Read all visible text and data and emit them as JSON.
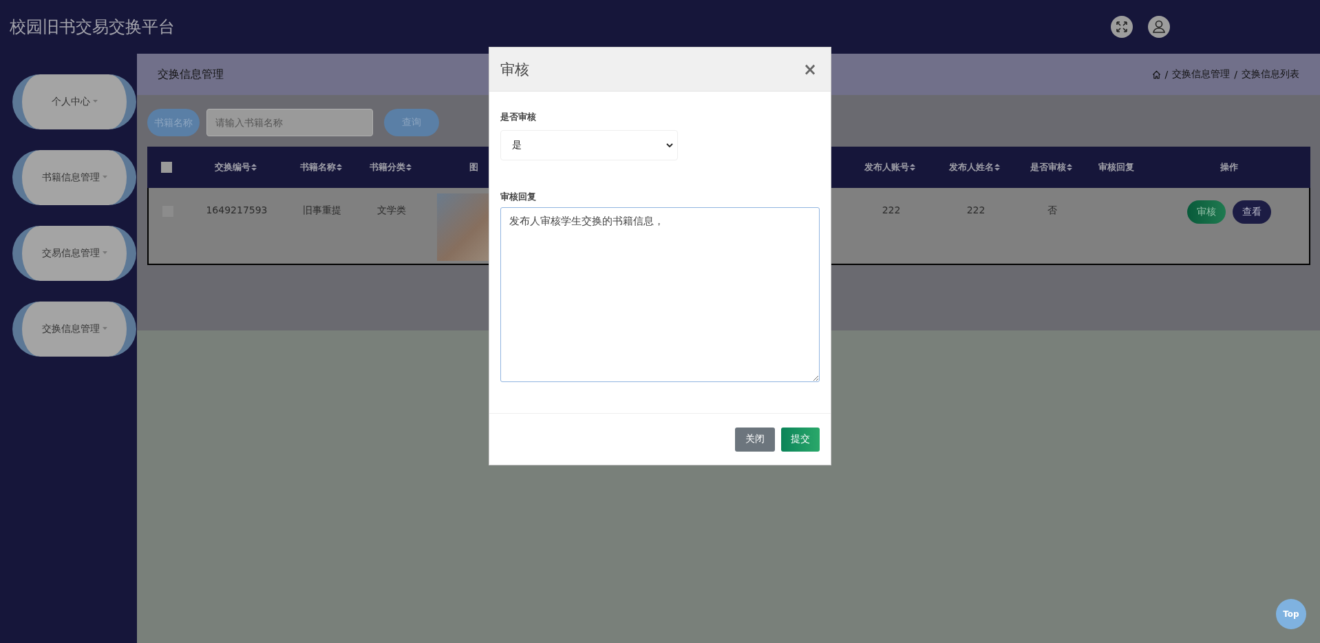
{
  "header": {
    "title": "校园旧书交易交换平台"
  },
  "sidebar": {
    "items": [
      {
        "label": "个人中心"
      },
      {
        "label": "书籍信息管理"
      },
      {
        "label": "交易信息管理"
      },
      {
        "label": "交换信息管理"
      }
    ]
  },
  "page": {
    "title": "交换信息管理"
  },
  "breadcrumb": [
    {
      "kind": "home"
    },
    {
      "kind": "sep",
      "text": "/"
    },
    {
      "kind": "link",
      "text": "交换信息管理"
    },
    {
      "kind": "sep",
      "text": "/"
    },
    {
      "kind": "link",
      "text": "交换信息列表"
    }
  ],
  "search": {
    "label": "书籍名称",
    "placeholder": "请输入书籍名称",
    "button": "查询"
  },
  "table": {
    "columns": [
      {
        "kind": "check",
        "checked": false
      },
      {
        "kind": "text",
        "label": "交换编号",
        "sortable": true
      },
      {
        "kind": "text",
        "label": "书籍名称",
        "sortable": true
      },
      {
        "kind": "text",
        "label": "书籍分类",
        "sortable": true
      },
      {
        "kind": "text",
        "label": "图",
        "sortable": false
      },
      {
        "kind": "hidden"
      },
      {
        "kind": "text",
        "label": "发布人账号",
        "sortable": true
      },
      {
        "kind": "text",
        "label": "发布人姓名",
        "sortable": true
      },
      {
        "kind": "text",
        "label": "是否审核",
        "sortable": true
      },
      {
        "kind": "text",
        "label": "审核回复",
        "sortable": false
      },
      {
        "kind": "text",
        "label": "操作",
        "sortable": false
      }
    ],
    "rows": [
      {
        "checked": false,
        "cells": [
          {
            "kind": "check"
          },
          {
            "kind": "text",
            "text": "1649217593"
          },
          {
            "kind": "text",
            "text": "旧事重提"
          },
          {
            "kind": "text",
            "text": "文学类"
          },
          {
            "kind": "photo"
          },
          {
            "kind": "hidden"
          },
          {
            "kind": "text",
            "text": "222"
          },
          {
            "kind": "text",
            "text": "222"
          },
          {
            "kind": "text",
            "text": "否"
          },
          {
            "kind": "empty"
          },
          {
            "kind": "actions",
            "buttons": [
              {
                "label": "审核",
                "kind": "review"
              },
              {
                "label": "查看",
                "kind": "view"
              }
            ]
          }
        ]
      }
    ]
  },
  "modal": {
    "title": "审核",
    "close": "×",
    "fields": [
      {
        "kind": "select",
        "label": "是否审核",
        "value": "是"
      },
      {
        "kind": "textarea",
        "label": "审核回复",
        "value": "发布人审核学生交换的书籍信息，"
      }
    ],
    "buttons": [
      {
        "label": "关闭",
        "kind": "secondary"
      },
      {
        "label": "提交",
        "kind": "primary"
      }
    ]
  },
  "top_button": {
    "label": "Top"
  }
}
